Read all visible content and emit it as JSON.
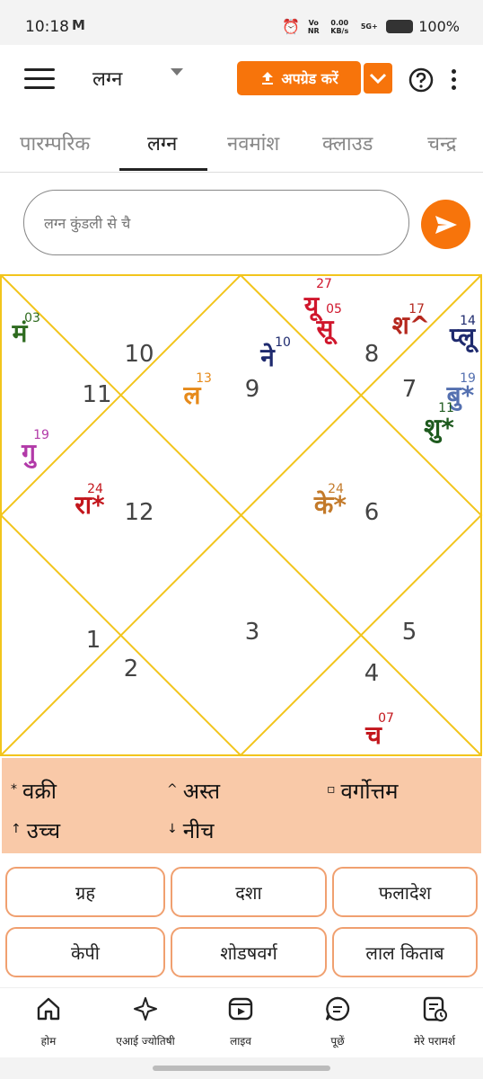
{
  "status_bar": {
    "time": "10:18",
    "net_icon": "M",
    "right_small_1": "Vo NR",
    "right_small_2": "0.00 KB/s",
    "right_small_3": "5G+",
    "battery": "100%"
  },
  "toolbar": {
    "title": "लग्न",
    "upgrade_label": "अपग्रेड करें",
    "accent": "#f7740b"
  },
  "tabs": [
    {
      "label": "पारम्परिक"
    },
    {
      "label": "लग्न"
    },
    {
      "label": "नवमांश"
    },
    {
      "label": "क्लाउड"
    },
    {
      "label": "चन्द्र"
    }
  ],
  "search": {
    "placeholder": "लग्न कुंडली से चै"
  },
  "chart": {
    "border_color": "#f2c51c",
    "house_numbers": [
      "10",
      "11",
      "9",
      "8",
      "7",
      "12",
      "6",
      "1",
      "3",
      "5",
      "2",
      "4"
    ],
    "planets": [
      {
        "name": "मं",
        "deg": "03",
        "color": "#2e6b1f"
      },
      {
        "name": "गु",
        "deg": "19",
        "color": "#b23aa8"
      },
      {
        "name": "रा*",
        "deg": "24",
        "color": "#c3161c"
      },
      {
        "name": "ल",
        "deg": "13",
        "color": "#e68a1a"
      },
      {
        "name": "ने",
        "deg": "10",
        "color": "#1e2a6e"
      },
      {
        "name": "यू",
        "deg": "27",
        "color": "#d0162c"
      },
      {
        "name": "सू",
        "deg": "05",
        "color": "#d0162c"
      },
      {
        "name": "श^",
        "deg": "17",
        "color": "#b5281e"
      },
      {
        "name": "प्लू",
        "deg": "14",
        "color": "#1e2a6e"
      },
      {
        "name": "बु*",
        "deg": "19",
        "color": "#5470b0"
      },
      {
        "name": "शु*",
        "deg": "11",
        "color": "#1e5a1e"
      },
      {
        "name": "के*",
        "deg": "24",
        "color": "#c37a2a"
      },
      {
        "name": "च",
        "deg": "07",
        "color": "#c3161c"
      }
    ]
  },
  "legend": {
    "retro": {
      "sym": "*",
      "label": "वक्री"
    },
    "combust": {
      "sym": "^",
      "label": "अस्त"
    },
    "vargottam": {
      "sym": "▫",
      "label": "वर्गोत्तम"
    },
    "exalted": {
      "sym": "↑",
      "label": "उच्च"
    },
    "debilitated": {
      "sym": "↓",
      "label": "नीच"
    }
  },
  "buttons": [
    "ग्रह",
    "दशा",
    "फलादेश",
    "केपी",
    "शोडषवर्ग",
    "लाल किताब"
  ],
  "bottom_nav": [
    "होम",
    "एआई ज्योतिषी",
    "लाइव",
    "पूछें",
    "मेरे परामर्श"
  ]
}
